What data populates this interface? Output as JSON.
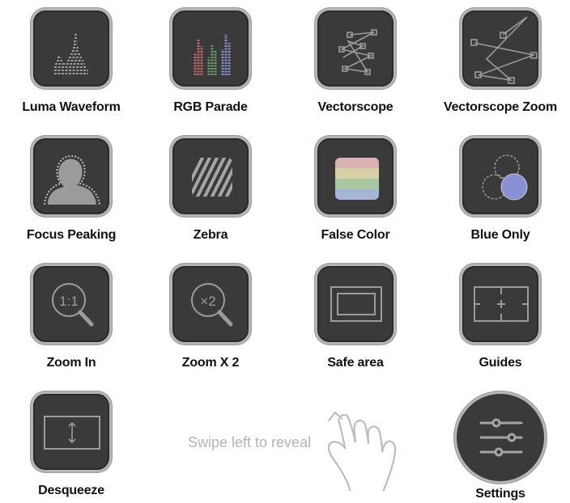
{
  "tools": [
    {
      "label": "Luma Waveform",
      "icon": "luma-waveform-icon"
    },
    {
      "label": "RGB Parade",
      "icon": "rgb-parade-icon"
    },
    {
      "label": "Vectorscope",
      "icon": "vectorscope-icon"
    },
    {
      "label": "Vectorscope Zoom",
      "icon": "vectorscope-zoom-icon"
    },
    {
      "label": "Focus Peaking",
      "icon": "focus-peaking-icon"
    },
    {
      "label": "Zebra",
      "icon": "zebra-icon"
    },
    {
      "label": "False Color",
      "icon": "false-color-icon"
    },
    {
      "label": "Blue Only",
      "icon": "blue-only-icon"
    },
    {
      "label": "Zoom In",
      "icon": "zoom-in-icon",
      "glyph": "1:1"
    },
    {
      "label": "Zoom X 2",
      "icon": "zoom-x2-icon",
      "glyph": "×2"
    },
    {
      "label": "Safe area",
      "icon": "safe-area-icon"
    },
    {
      "label": "Guides",
      "icon": "guides-icon"
    },
    {
      "label": "Desqueeze",
      "icon": "desqueeze-icon"
    }
  ],
  "settings": {
    "label": "Settings",
    "icon": "sliders-icon"
  },
  "hint": {
    "text": "Swipe left to reveal",
    "icon": "swipe-hand-icon"
  },
  "colors": {
    "button_bg": "#3a3a3a",
    "button_border": "#b5b5b5",
    "icon_stroke": "#9b9b9b",
    "red": "#c56a6a",
    "green": "#6aa36a",
    "blue": "#8a90d6",
    "false_color_bands": [
      "#d9b2b4",
      "#d8d0a5",
      "#a9c7a1",
      "#a6b5d6"
    ]
  }
}
